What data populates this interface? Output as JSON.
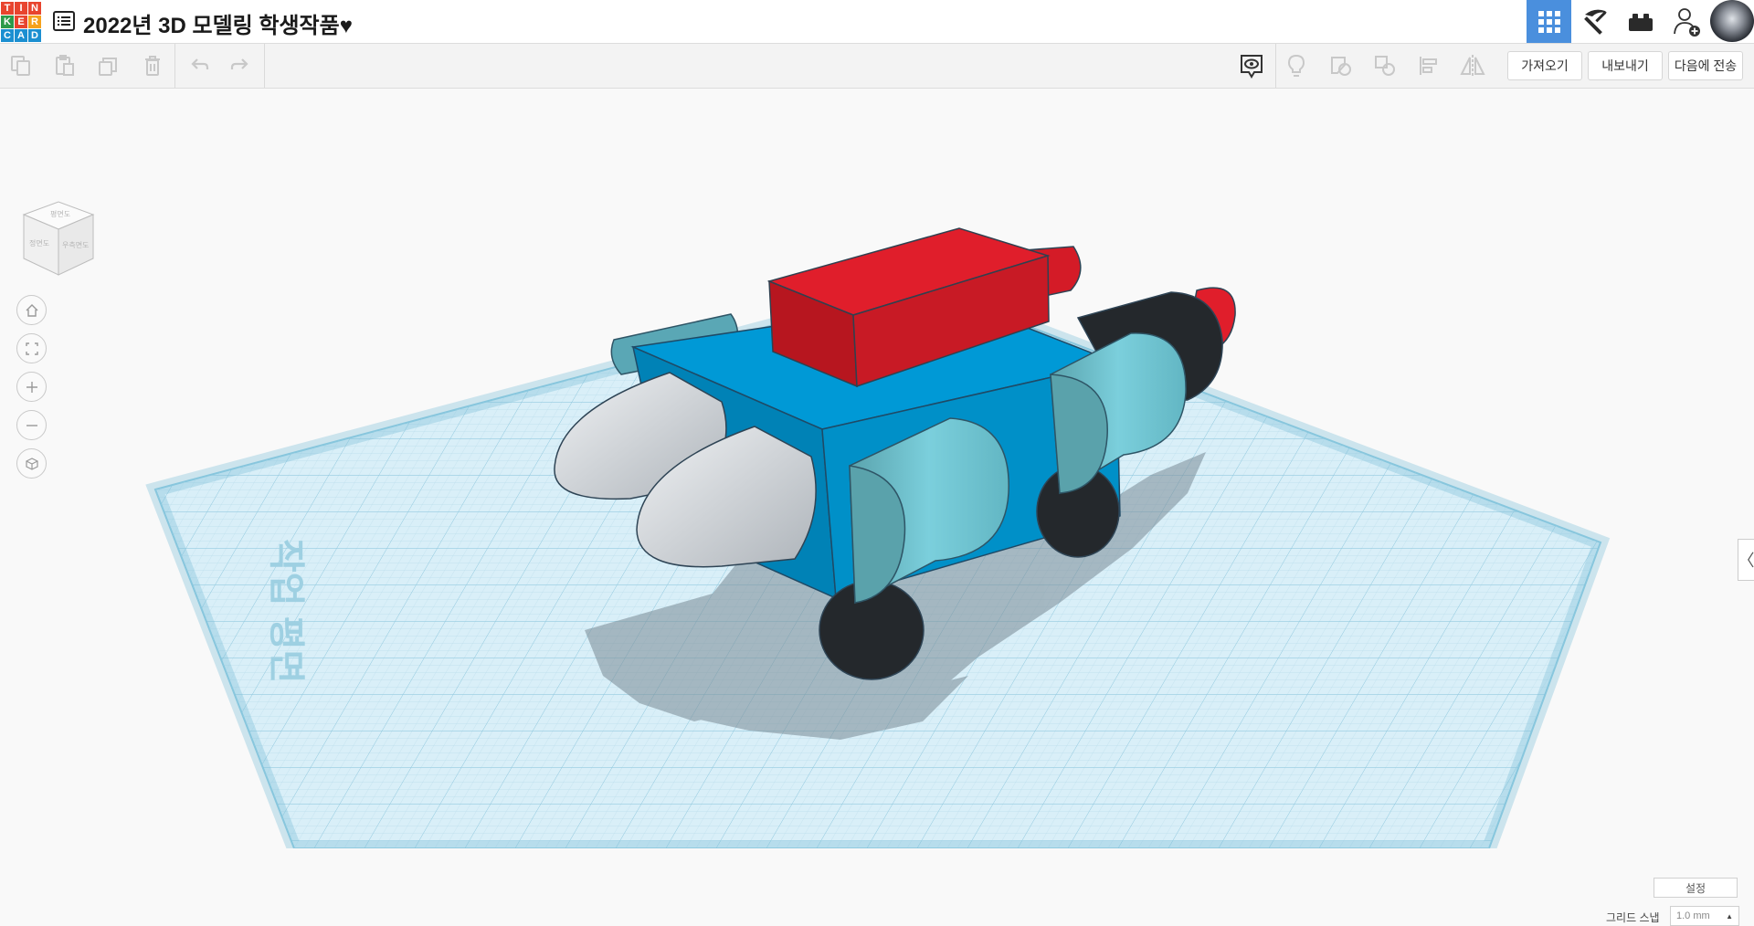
{
  "logo": {
    "letters": [
      "T",
      "I",
      "N",
      "K",
      "E",
      "R",
      "C",
      "A",
      "D"
    ],
    "colors": [
      "#e8442e",
      "#e8442e",
      "#e8442e",
      "#2c9a49",
      "#e8442e",
      "#f5a11c",
      "#1b8fd1",
      "#1b8fd1",
      "#1b8fd1"
    ]
  },
  "header": {
    "title": "2022년 3D 모델링 학생작품♥"
  },
  "nav": {
    "grid_icon": "grid-view-icon",
    "pickaxe_icon": "pickaxe-icon",
    "bricks_icon": "bricks-icon",
    "user_add_icon": "user-add-icon",
    "accent": "#4a8fdd"
  },
  "toolbar": {
    "import_label": "가져오기",
    "export_label": "내보내기",
    "send_to_label": "다음에 전송"
  },
  "viewcube": {
    "top": "평면도",
    "front": "정면도",
    "right": "우측면도"
  },
  "workplane": {
    "label": "작업 평면"
  },
  "bottom": {
    "settings_label": "설정",
    "snap_label": "그리드 스냅",
    "snap_value": "1.0 mm"
  },
  "colors": {
    "workplane": "#cfe9f4",
    "grid_line": "#a9d3e6",
    "body": "#0099d6",
    "red": "#e01e2b",
    "light_blue": "#6fc6d4",
    "white": "#dcdfe2",
    "black": "#262a2e"
  }
}
